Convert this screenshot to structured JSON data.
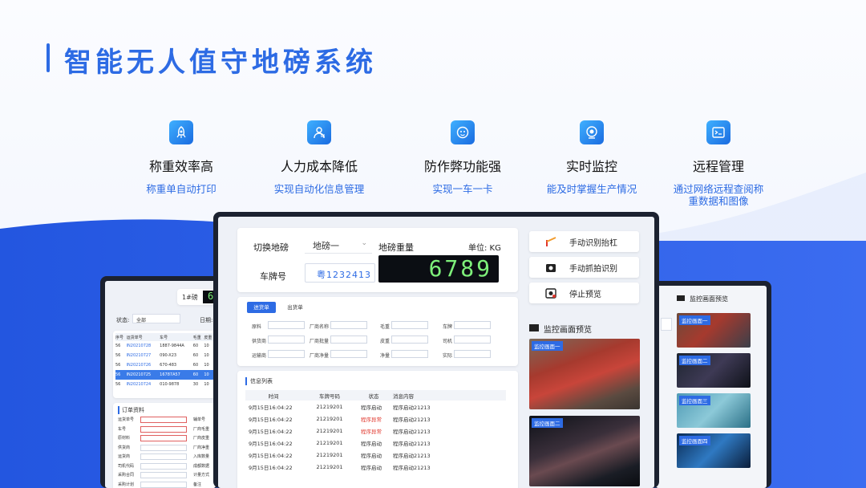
{
  "page": {
    "title": "智能无人值守地磅系统"
  },
  "features": [
    {
      "icon": "rocket-icon",
      "title": "称重效率高",
      "subtitle": "称重单自动打印"
    },
    {
      "icon": "user-card-icon",
      "title": "人力成本降低",
      "subtitle": "实现自动化信息管理"
    },
    {
      "icon": "shield-lock-icon",
      "title": "防作弊功能强",
      "subtitle": "实现一车一卡"
    },
    {
      "icon": "camera-lens-icon",
      "title": "实时监控",
      "subtitle": "能及时掌握生产情况"
    },
    {
      "icon": "terminal-icon",
      "title": "远程管理",
      "subtitle": "通过网络远程查阅称\n重数据和图像"
    }
  ],
  "main_app": {
    "switch_label": "切换地磅",
    "switch_value": "地磅一",
    "weight_label": "地磅重量",
    "unit_label": "单位: KG",
    "weight_value": "6789",
    "plate_label": "车牌号",
    "plate_value": "粤1232413",
    "tabs": [
      "进货单",
      "出货单"
    ],
    "form_labels": [
      "原料",
      "厂商名称",
      "毛重",
      "车牌",
      "供货商",
      "厂商批量",
      "皮重",
      "司机",
      "运输商",
      "厂商净量",
      "净量",
      "实际"
    ],
    "list_title": "信息列表",
    "list_headers": [
      "时间",
      "车牌号码",
      "状态",
      "消息内容"
    ],
    "list_rows": [
      {
        "time": "9月15日16:04:22",
        "plate": "21219201",
        "status": "程序启动",
        "msg": "程序启动21213",
        "alert": false
      },
      {
        "time": "9月15日16:04:22",
        "plate": "21219201",
        "status": "程序异常",
        "msg": "程序启动21213",
        "alert": true
      },
      {
        "time": "9月15日16:04:22",
        "plate": "21219201",
        "status": "程序异常",
        "msg": "程序启动21213",
        "alert": true
      },
      {
        "time": "9月15日16:04:22",
        "plate": "21219201",
        "status": "程序启动",
        "msg": "程序启动21213",
        "alert": false
      },
      {
        "time": "9月15日16:04:22",
        "plate": "21219201",
        "status": "程序启动",
        "msg": "程序启动21213",
        "alert": false
      },
      {
        "time": "9月15日16:04:22",
        "plate": "21219201",
        "status": "程序启动",
        "msg": "程序启动21213",
        "alert": false
      }
    ],
    "action_buttons": [
      {
        "icon": "barrier-icon",
        "label": "手动识别抬杠"
      },
      {
        "icon": "camera-icon",
        "label": "手动抓拍识别"
      },
      {
        "icon": "stop-preview-icon",
        "label": "停止预览"
      }
    ],
    "monitor_title": "监控画面预览",
    "cams": [
      "监控画面一",
      "监控画面二"
    ]
  },
  "left_app": {
    "scale_label": "1#磅",
    "weight_digit": "6",
    "status_label": "状态:",
    "status_value": "全部",
    "date_label": "日期:",
    "table_headers": [
      "序号",
      "运货单号",
      "车号",
      "毛重",
      "皮重"
    ],
    "rows": [
      [
        "56",
        "IN20210728",
        "1887-9844A",
        "60",
        "10"
      ],
      [
        "56",
        "IN20210727",
        "090-X23",
        "60",
        "10"
      ],
      [
        "56",
        "IN20210726",
        "670-483",
        "60",
        "10"
      ],
      [
        "56",
        "IN20210725",
        "16787A57",
        "60",
        "10"
      ],
      [
        "56",
        "IN20210724",
        "010-9878",
        "30",
        "10"
      ]
    ],
    "order_title": "订单资料",
    "order_fields": [
      "运货单号",
      "车号",
      "原材料",
      "供货商",
      "运货商",
      "司机代码",
      "采购合同",
      "采购计划"
    ],
    "order_right": [
      "辅单号",
      "厂商毛重",
      "厂商皮重",
      "厂商净重",
      "入库数量",
      "成都数据",
      "计量方式",
      "备注"
    ]
  },
  "right_app": {
    "monitor_title": "监控画面预览",
    "cams": [
      "监控画面一",
      "监控画面二",
      "监控画面三",
      "监控画面四"
    ]
  },
  "colors": {
    "accent": "#2d6be4",
    "wave": "#2f5fe6",
    "lcd": "#7ef07a"
  }
}
